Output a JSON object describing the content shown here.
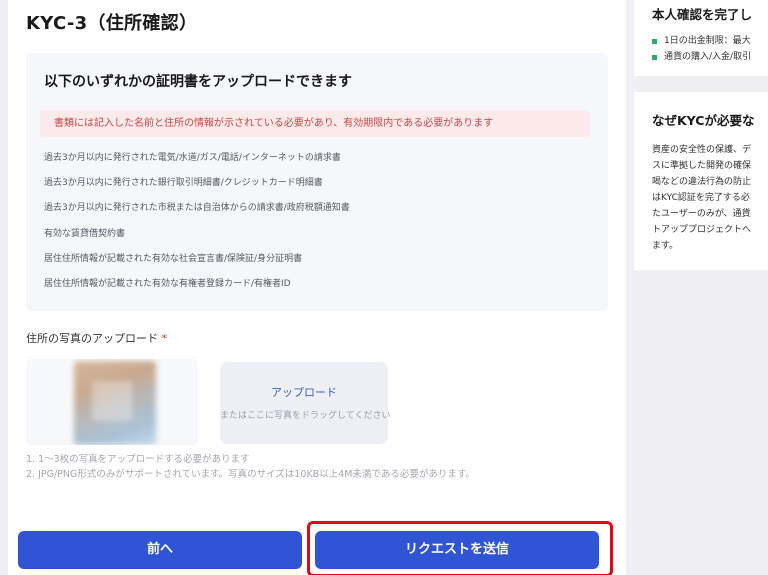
{
  "main": {
    "title": "KYC-3（住所確認）",
    "info": {
      "heading": "以下のいずれかの証明書をアップロードできます",
      "warning": "書類には記入した名前と住所の情報が示されている必要があり、有効期限内である必要があります",
      "documents": [
        "過去3か月以内に発行された電気/水道/ガス/電話/インターネットの請求書",
        "過去3か月以内に発行された銀行取引明細書/クレジットカード明細書",
        "過去3か月以内に発行された市税または自治体からの請求書/政府税額通知書",
        "有効な賃貸借契約書",
        "居住住所情報が記載された有効な社会宣言書/保険証/身分証明書",
        "居住住所情報が記載された有効な有権者登録カード/有権者ID"
      ]
    },
    "upload": {
      "label": "住所の写真のアップロード",
      "required_mark": "*",
      "dropzone_link": "アップロード",
      "dropzone_hint": "またはここに写真をドラッグしてください"
    },
    "notes": [
      "1. 1～3枚の写真をアップロードする必要があります",
      "2. JPG/PNG形式のみがサポートされています。写真のサイズは10KB以上4M未満である必要があります。"
    ],
    "buttons": {
      "prev": "前へ",
      "submit": "リクエストを送信"
    }
  },
  "right": {
    "top": {
      "title": "本人確認を完了し",
      "bullets": [
        "1日の出金制限：最大",
        "通貨の購入/入金/取引"
      ]
    },
    "why": {
      "title": "なぜKYCが必要な",
      "lines": [
        "資産の安全性の保護、デ",
        "スに準拠した開発の確保",
        "喝などの違法行為の防止",
        "はKYC認証を完了する必",
        "たユーザーのみが、通貨",
        "トアッププロジェクトへ",
        "ます。"
      ]
    }
  },
  "colors": {
    "primary_button": "#2f55d4",
    "warning_text": "#d14848",
    "warning_bg": "#fdeaea",
    "highlight_frame": "#e0081a",
    "bullet": "#27b36b"
  }
}
